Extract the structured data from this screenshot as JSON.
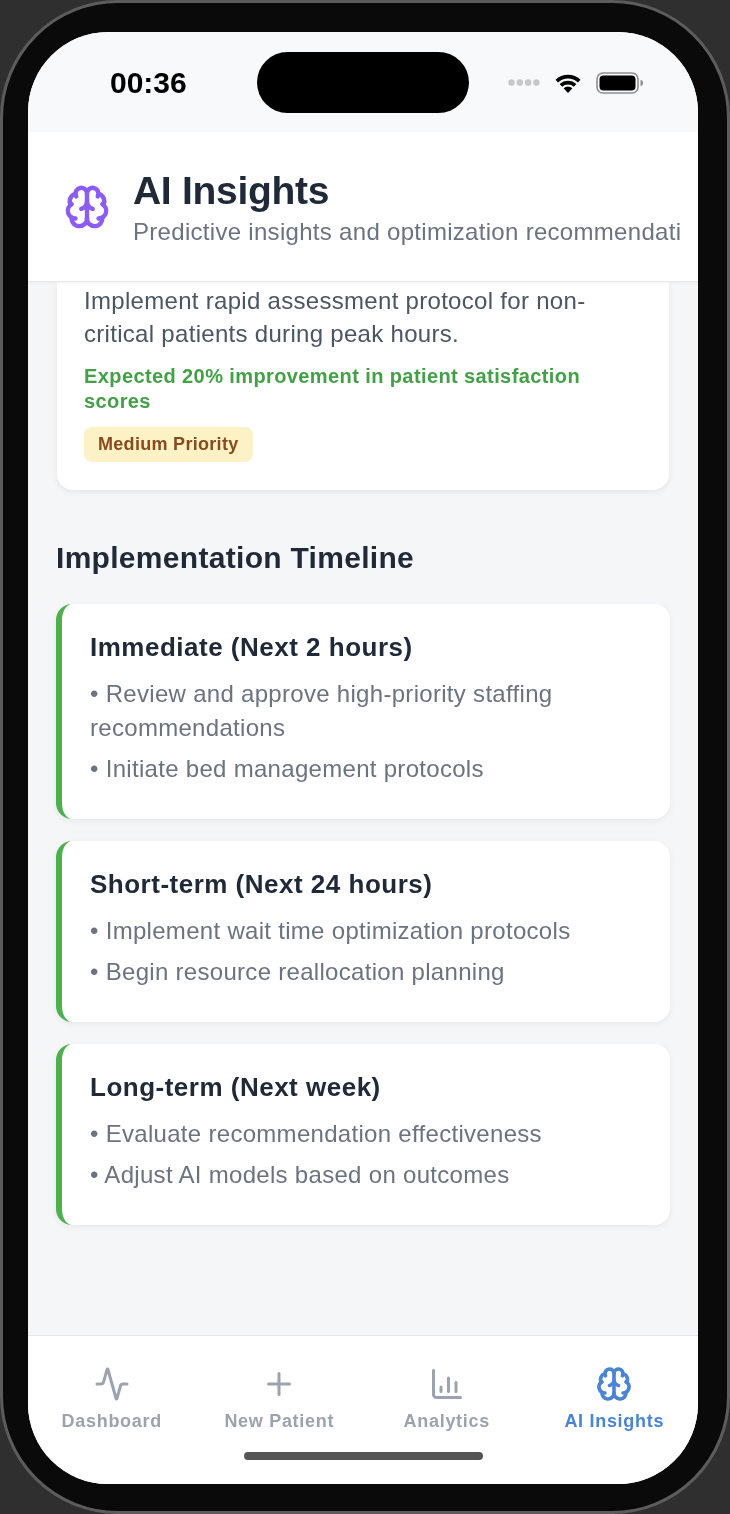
{
  "status_bar": {
    "time": "00:36"
  },
  "header": {
    "title": "AI Insights",
    "subtitle": "Predictive insights and optimization recommendati"
  },
  "recommendation_card": {
    "description": "Implement rapid assessment protocol for non-critical patients during peak hours.",
    "impact": "Expected 20% improvement in patient satisfaction scores",
    "priority": "Medium Priority"
  },
  "timeline": {
    "title": "Implementation Timeline",
    "phases": [
      {
        "title": "Immediate (Next 2 hours)",
        "items": [
          "• Review and approve high-priority staffing recommendations",
          "• Initiate bed management protocols"
        ]
      },
      {
        "title": "Short-term (Next 24 hours)",
        "items": [
          "• Implement wait time optimization protocols",
          "• Begin resource reallocation planning"
        ]
      },
      {
        "title": "Long-term (Next week)",
        "items": [
          "• Evaluate recommendation effectiveness",
          "• Adjust AI models based on outcomes"
        ]
      }
    ]
  },
  "tab_bar": {
    "tabs": [
      {
        "label": "Dashboard",
        "selected": false
      },
      {
        "label": "New Patient",
        "selected": false
      },
      {
        "label": "Analytics",
        "selected": false
      },
      {
        "label": "AI Insights",
        "selected": true
      }
    ]
  }
}
